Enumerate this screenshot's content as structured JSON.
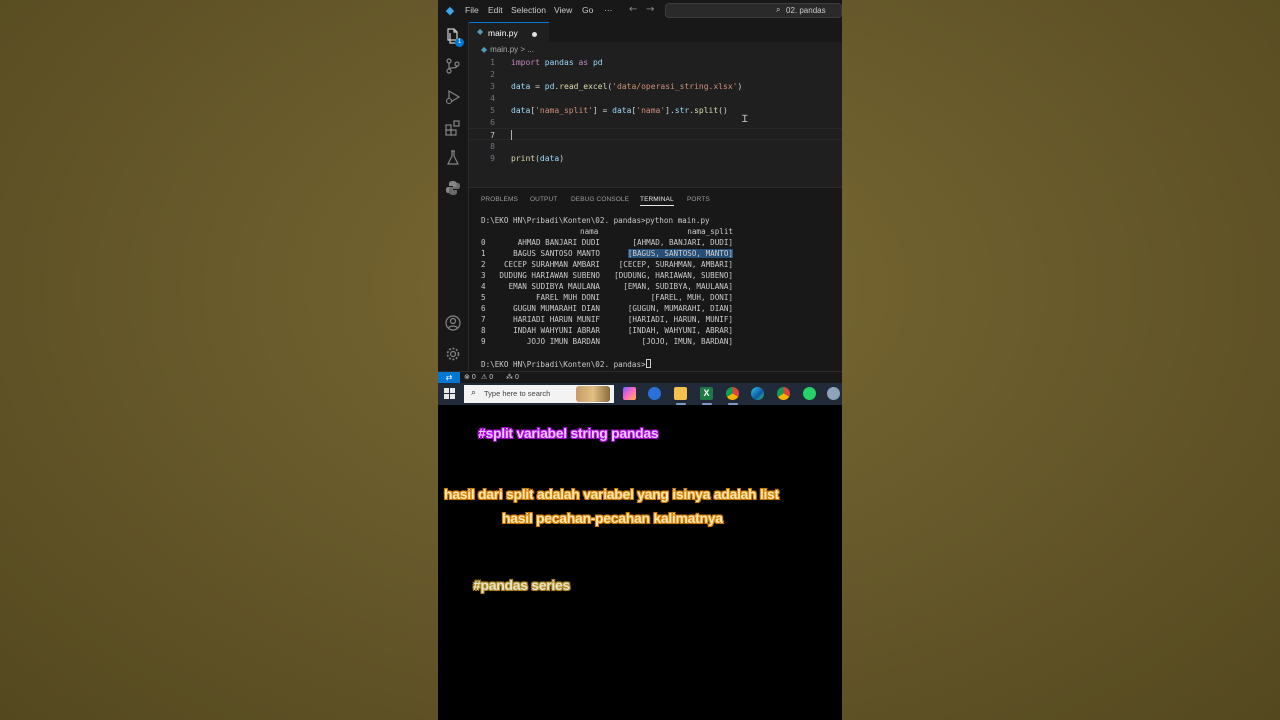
{
  "window": {
    "menu": [
      "File",
      "Edit",
      "Selection",
      "View",
      "Go",
      "···"
    ],
    "search_text": "02. pandas"
  },
  "editor": {
    "tab_label": "main.py",
    "breadcrumb_file": "main.py",
    "breadcrumb_sep": ">",
    "breadcrumb_more": "...",
    "lines": [
      {
        "n": "1",
        "code": "import pandas as pd"
      },
      {
        "n": "2",
        "code": ""
      },
      {
        "n": "3",
        "code": "data = pd.read_excel('data/operasi_string.xlsx')"
      },
      {
        "n": "4",
        "code": ""
      },
      {
        "n": "5",
        "code": "data['nama_split'] = data['nama'].str.split()"
      },
      {
        "n": "6",
        "code": ""
      },
      {
        "n": "7",
        "code": ""
      },
      {
        "n": "8",
        "code": ""
      },
      {
        "n": "9",
        "code": "print(data)"
      }
    ]
  },
  "panel": {
    "tabs": [
      "PROBLEMS",
      "OUTPUT",
      "DEBUG CONSOLE",
      "TERMINAL",
      "PORTS"
    ],
    "active_tab": "TERMINAL"
  },
  "terminal": {
    "command_line": "D:\\EKO HN\\Pribadi\\Konten\\02. pandas>python main.py",
    "headers": [
      "nama",
      "nama_split"
    ],
    "rows": [
      {
        "i": "0",
        "nama": "AHMAD BANJARI DUDI",
        "split": "[AHMAD, BANJARI, DUDI]"
      },
      {
        "i": "1",
        "nama": "BAGUS SANTOSO MANTO",
        "split": "[BAGUS, SANTOSO, MANTO]"
      },
      {
        "i": "2",
        "nama": "CECEP SURAHMAN AMBARI",
        "split": "[CECEP, SURAHMAN, AMBARI]"
      },
      {
        "i": "3",
        "nama": "DUDUNG HARIAWAN SUBENO",
        "split": "[DUDUNG, HARIAWAN, SUBENO]"
      },
      {
        "i": "4",
        "nama": "EMAN SUDIBYA MAULANA",
        "split": "[EMAN, SUDIBYA, MAULANA]"
      },
      {
        "i": "5",
        "nama": "FAREL MUH DONI",
        "split": "[FAREL, MUH, DONI]"
      },
      {
        "i": "6",
        "nama": "GUGUN MUMARAHI DIAN",
        "split": "[GUGUN, MUMARAHI, DIAN]"
      },
      {
        "i": "7",
        "nama": "HARIADI HARUN MUNIF",
        "split": "[HARIADI, HARUN, MUNIF]"
      },
      {
        "i": "8",
        "nama": "INDAH WAHYUNI ABRAR",
        "split": "[INDAH, WAHYUNI, ABRAR]"
      },
      {
        "i": "9",
        "nama": "JOJO IMUN BARDAN",
        "split": "[JOJO, IMUN, BARDAN]"
      }
    ],
    "prompt": "D:\\EKO HN\\Pribadi\\Konten\\02. pandas>"
  },
  "statusbar": {
    "errors": "0",
    "warnings": "0",
    "ports": "0"
  },
  "taskbar": {
    "search_placeholder": "Type here to search"
  },
  "captions": {
    "hashtag_top": "#split variabel string pandas",
    "line1": "hasil dari split adalah variabel yang isinya adalah list",
    "line2": "hasil pecahan-pecahan kalimatnya",
    "hashtag_bottom": "#pandas series"
  },
  "colors": {
    "accent": "#0078d4",
    "keyword": "#c586c0",
    "variable": "#9cdcfe",
    "function": "#dcdcaa",
    "string": "#ce9178"
  }
}
